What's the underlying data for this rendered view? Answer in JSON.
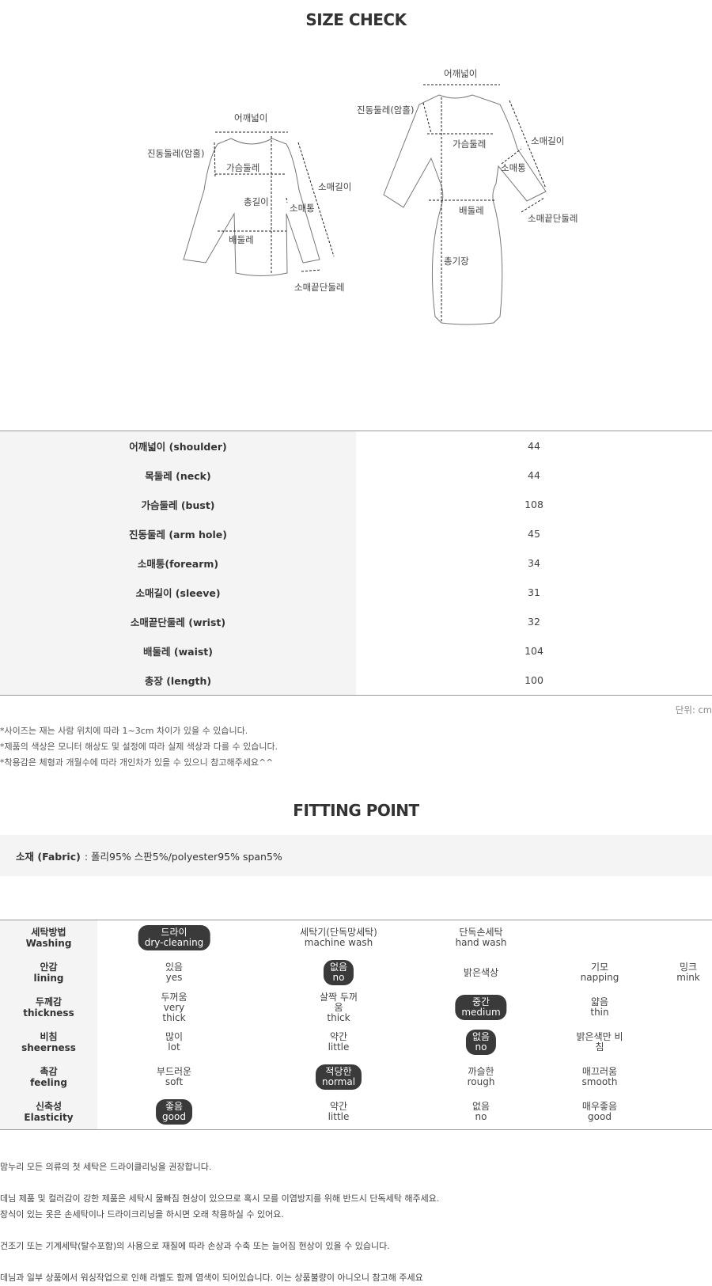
{
  "size_check": {
    "title": "SIZE CHECK",
    "top_labels": {
      "shoulder": "어깨넓이",
      "armhole": "진동둘레(암홀)",
      "bust": "가슴둘레",
      "total_length": "총길이",
      "forearm": "소매통",
      "sleeve_length": "소매길이",
      "waist": "배둘레",
      "cuff": "소매끝단둘레"
    },
    "dress_labels": {
      "shoulder": "어깨넓이",
      "armhole": "진동둘레(암홀)",
      "bust": "가슴둘레",
      "sleeve_length": "소매길이",
      "forearm": "소매통",
      "waist": "배둘레",
      "cuff": "소매끝단둘레",
      "total_length": "총기장"
    },
    "rows": [
      {
        "label": "어깨넓이 (shoulder)",
        "value": "44"
      },
      {
        "label": "목둘레 (neck)",
        "value": "44"
      },
      {
        "label": "가슴둘레 (bust)",
        "value": "108"
      },
      {
        "label": "진동둘레 (arm hole)",
        "value": "45"
      },
      {
        "label": "소매통(forearm)",
        "value": "34"
      },
      {
        "label": "소매길이 (sleeve)",
        "value": "31"
      },
      {
        "label": "소매끝단둘레 (wrist)",
        "value": "32"
      },
      {
        "label": "배둘레 (waist)",
        "value": "104"
      },
      {
        "label": "총장 (length)",
        "value": "100"
      }
    ],
    "unit": "단위: cm",
    "notes": [
      "*사이즈는 재는 사람 위치에 따라 1~3cm 차이가 있을 수 있습니다.",
      "*제품의 색상은 모니터 해상도 및 설정에 따라 실제 색상과 다를 수 있습니다.",
      "*착용감은 체형과 개월수에 따라 개인차가 있을 수 있으니 참고해주세요^^"
    ]
  },
  "fitting_point": {
    "title": "FITTING POINT",
    "fabric_label": "소재 (Fabric)",
    "fabric_value": ": 폴리95% 스판5%/polyester95% span5%",
    "rows": [
      {
        "ko": "세탁방법",
        "en": "Washing",
        "options": [
          {
            "ko": "드라이",
            "en": "dry-cleaning",
            "selected": true
          },
          {
            "ko": "세탁기(단독망세탁)",
            "en": "machine wash",
            "selected": false
          },
          {
            "ko": "단독손세탁",
            "en": "hand wash",
            "selected": false
          }
        ]
      },
      {
        "ko": "안감",
        "en": "lining",
        "options": [
          {
            "ko": "있음",
            "en": "yes",
            "selected": false
          },
          {
            "ko": "없음",
            "en": "no",
            "selected": true
          },
          {
            "ko": "밝은색상",
            "en": "",
            "selected": false
          },
          {
            "ko": "기모",
            "en": "napping",
            "selected": false
          },
          {
            "ko": "밍크",
            "en": "mink",
            "selected": false
          }
        ]
      },
      {
        "ko": "두께감",
        "en": "thickness",
        "options": [
          {
            "ko": "두꺼움",
            "en": "very\nthick",
            "selected": false
          },
          {
            "ko": "살짝 두꺼\n움",
            "en": "thick",
            "selected": false
          },
          {
            "ko": "중간",
            "en": "medium",
            "selected": true
          },
          {
            "ko": "얇음",
            "en": "thin",
            "selected": false
          }
        ]
      },
      {
        "ko": "비침",
        "en": "sheerness",
        "options": [
          {
            "ko": "많이",
            "en": "lot",
            "selected": false
          },
          {
            "ko": "약간",
            "en": "little",
            "selected": false
          },
          {
            "ko": "없음",
            "en": "no",
            "selected": true
          },
          {
            "ko": "밝은색만 비\n침",
            "en": "",
            "selected": false
          }
        ]
      },
      {
        "ko": "촉감",
        "en": "feeling",
        "options": [
          {
            "ko": "부드러운",
            "en": "soft",
            "selected": false
          },
          {
            "ko": "적당한",
            "en": "normal",
            "selected": true
          },
          {
            "ko": "까슬한",
            "en": "rough",
            "selected": false
          },
          {
            "ko": "매끄러움",
            "en": "smooth",
            "selected": false
          }
        ]
      },
      {
        "ko": "신축성",
        "en": "Elasticity",
        "options": [
          {
            "ko": "좋음",
            "en": "good",
            "selected": true
          },
          {
            "ko": "약간",
            "en": "little",
            "selected": false
          },
          {
            "ko": "없음",
            "en": "no",
            "selected": false
          },
          {
            "ko": "매우좋음",
            "en": "good",
            "selected": false
          }
        ]
      }
    ]
  },
  "care_notes": [
    "맘누리 모든 의류의 첫 세탁은 드라이클리닝을 권장합니다.",
    "데님 제품 및 컬러감이 강한 제품은 세탁시 물빠짐 현상이 있으므로 혹시 모를 이염방지를 위해 반드시 단독세탁 해주세요.",
    "장식이 있는 옷은 손세탁이나 드라이크리닝을 하시면 오래 착용하실 수 있어요.",
    "건조기 또는 기계세탁(탈수포함)의 사용으로 재질에 따라 손상과 수축 또는 늘어짐 현상이 있을 수 있습니다.",
    "데님과 일부 상품에서 워싱작업으로 인해 라벨도 함께 염색이 되어있습니다. 이는 상품불량이 아니오니 참고해 주세요"
  ]
}
